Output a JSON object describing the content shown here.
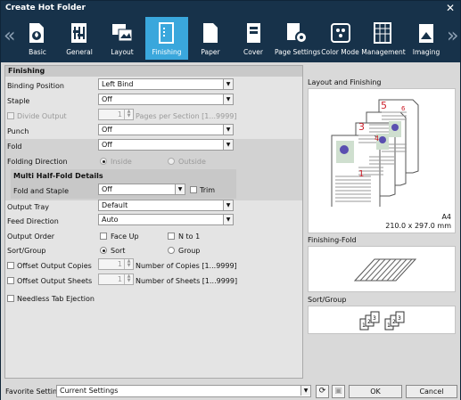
{
  "window": {
    "title": "Create Hot Folder",
    "close": "✕"
  },
  "tabs": [
    {
      "label": "Basic",
      "icon": "basic-icon"
    },
    {
      "label": "General",
      "icon": "general-icon"
    },
    {
      "label": "Layout",
      "icon": "layout-icon"
    },
    {
      "label": "Finishing",
      "icon": "finishing-icon",
      "active": true
    },
    {
      "label": "Paper",
      "icon": "paper-icon"
    },
    {
      "label": "Cover",
      "icon": "cover-icon"
    },
    {
      "label": "Page Settings",
      "icon": "page-settings-icon"
    },
    {
      "label": "Color Mode",
      "icon": "color-mode-icon"
    },
    {
      "label": "Management",
      "icon": "management-icon"
    },
    {
      "label": "Imaging",
      "icon": "imaging-icon"
    }
  ],
  "nav": {
    "prev": "«",
    "next": "»"
  },
  "finishing": {
    "heading": "Finishing",
    "binding_label": "Binding Position",
    "binding_value": "Left Bind",
    "staple_label": "Staple",
    "staple_value": "Off",
    "divide_label": "Divide Output",
    "divide_value": "1",
    "pages_per_section": "Pages per Section [1...9999]",
    "punch_label": "Punch",
    "punch_value": "Off",
    "fold_label": "Fold",
    "fold_value": "Off",
    "folding_dir_label": "Folding Direction",
    "inside": "Inside",
    "outside": "Outside",
    "multi_head": "Multi Half-Fold Details",
    "fold_staple_label": "Fold and Staple",
    "fold_staple_value": "Off",
    "trim": "Trim",
    "output_tray_label": "Output Tray",
    "output_tray_value": "Default",
    "feed_dir_label": "Feed Direction",
    "feed_dir_value": "Auto",
    "output_order_label": "Output Order",
    "face_up": "Face Up",
    "n_to_1": "N to 1",
    "sort_group_label": "Sort/Group",
    "sort": "Sort",
    "group": "Group",
    "offset_copies_label": "Offset Output Copies",
    "offset_copies_value": "1",
    "num_copies": "Number of Copies [1...9999]",
    "offset_sheets_label": "Offset Output Sheets",
    "offset_sheets_value": "1",
    "num_sheets": "Number of Sheets [1...9999]",
    "needless_tab": "Needless Tab Ejection"
  },
  "preview": {
    "layout_label": "Layout and Finishing",
    "page_nums": [
      "1",
      "3",
      "4",
      "5",
      "6"
    ],
    "paper_size": "A4",
    "paper_dims": "210.0 x 297.0 mm",
    "fold_label": "Finishing-Fold",
    "sort_label": "Sort/Group",
    "sort_nums": [
      "1",
      "2",
      "3",
      "1",
      "2",
      "3"
    ]
  },
  "footer": {
    "favorite_label": "Favorite Setting",
    "favorite_value": "Current Settings",
    "ok": "OK",
    "cancel": "Cancel"
  },
  "colors": {
    "title_bg": "#17324a",
    "active_tab": "#3aa7dc",
    "accent_red": "#cc1f2a"
  }
}
